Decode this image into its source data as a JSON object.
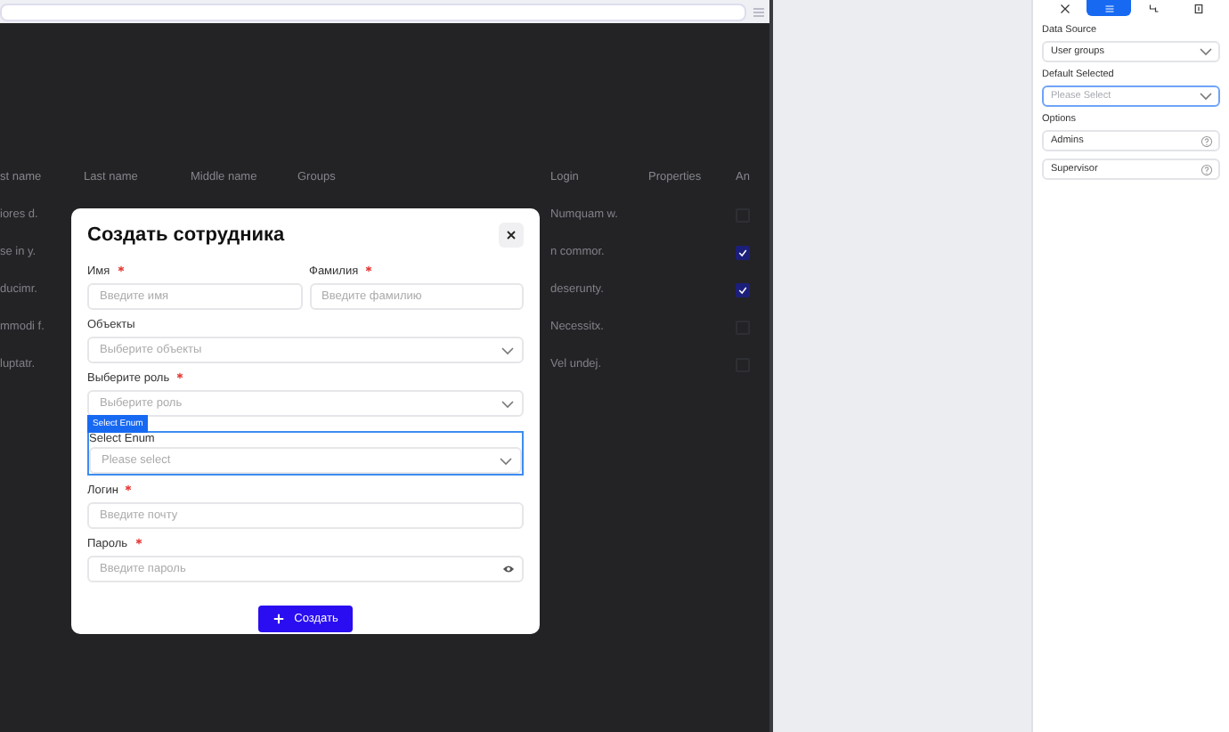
{
  "table": {
    "columns": [
      "st name",
      "Last name",
      "Middle name",
      "Groups",
      "Login",
      "Properties",
      "An"
    ],
    "rows": [
      {
        "cells": [
          "iores d."
        ],
        "groups": [],
        "login": "Numquam w.",
        "checked": false
      },
      {
        "cells": [
          "se in y."
        ],
        "groups": [],
        "login": "n commor.",
        "checked": true
      },
      {
        "cells": [
          "ducimr."
        ],
        "groups": [],
        "login": "deserunty.",
        "checked": true
      },
      {
        "cells": [
          "mmodi f."
        ],
        "groups": [],
        "login": "Necessitx.",
        "checked": false
      },
      {
        "cells": [
          "luptatr."
        ],
        "groups": [],
        "login": "Vel undej.",
        "checked": false
      }
    ]
  },
  "modal": {
    "title": "Создать сотрудника",
    "fields": [
      {
        "kind": "text",
        "label": "Имя",
        "required": true,
        "placeholder": "Введите имя",
        "highlighted": false,
        "half": true
      },
      {
        "kind": "text",
        "label": "Фамилия",
        "required": true,
        "placeholder": "Введите фамилию",
        "highlighted": false,
        "half": true
      },
      {
        "kind": "select",
        "label": "Объекты",
        "required": false,
        "placeholder": "Выберите объекты",
        "highlighted": false,
        "half": false
      },
      {
        "kind": "select",
        "label": "Выберите роль",
        "required": true,
        "placeholder": "Выберите роль",
        "highlighted": false,
        "half": false
      },
      {
        "kind": "select",
        "label": "Select Enum",
        "required": false,
        "placeholder": "Please select",
        "highlighted": true,
        "badge": "Select Enum",
        "half": false
      },
      {
        "kind": "text",
        "label": "Логин",
        "required": true,
        "placeholder": "Введите почту",
        "highlighted": false,
        "half": false
      },
      {
        "kind": "password",
        "label": "Пароль",
        "required": true,
        "placeholder": "Введите пароль",
        "highlighted": false,
        "half": false
      }
    ],
    "submit": "Создать"
  },
  "panel": {
    "tabs": [
      {
        "selected": false
      },
      {
        "selected": true
      },
      {
        "selected": false
      },
      {
        "selected": false
      }
    ],
    "data_source": {
      "label": "Data Source",
      "value": "User groups"
    },
    "default_selected": {
      "label": "Default Selected",
      "placeholder": "Please Select",
      "focused": true
    },
    "options": {
      "label": "Options",
      "items": [
        "Admins",
        "Supervisor"
      ]
    }
  }
}
